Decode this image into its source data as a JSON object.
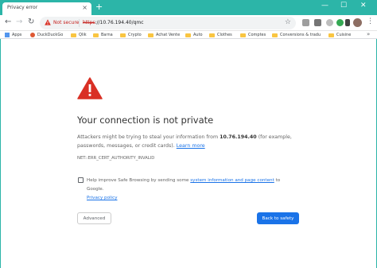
{
  "tab": {
    "title": "Privacy error",
    "close_glyph": "×",
    "new_tab_glyph": "+"
  },
  "window_controls": {
    "minimize": "—",
    "maximize": "☐",
    "close": "✕"
  },
  "nav": {
    "back": "←",
    "forward": "→",
    "reload": "↻"
  },
  "omnibox": {
    "security_label": "Not secure",
    "url_scheme": "https",
    "url_rest": "://10.76.194.40/qmc",
    "star_icon": "☆"
  },
  "extensions": [
    {
      "name": "extension-1-icon",
      "color": "#9e9e9e"
    },
    {
      "name": "extension-2-icon",
      "color": "#757575"
    },
    {
      "name": "extension-3-icon",
      "color": "#bdbdbd"
    },
    {
      "name": "extension-4-icon",
      "color": "#34a853"
    },
    {
      "name": "extension-5-icon",
      "color": "#424242"
    }
  ],
  "bookmarks": {
    "apps": "Apps",
    "items": [
      "DuckDuckGo",
      "Qlik",
      "Barna",
      "Crypto",
      "Achat Vente",
      "Auto",
      "Clothes",
      "Comptes",
      "Conversions & tradu",
      "Cuisine"
    ],
    "more": "»"
  },
  "content": {
    "heading": "Your connection is not private",
    "body_prefix": "Attackers might be trying to steal your information from ",
    "body_host": "10.76.194.40",
    "body_suffix": " (for example, passwords, messages, or credit cards). ",
    "learn_more": "Learn more",
    "error_code": "NET::ERR_CERT_AUTHORITY_INVALID",
    "safe_browsing_prefix": "Help improve Safe Browsing by sending some ",
    "safe_browsing_link": "system information and page content",
    "safe_browsing_suffix": " to Google.",
    "privacy_policy": "Privacy policy",
    "checkbox_checked": false
  },
  "buttons": {
    "advanced": "Advanced",
    "back_to_safety": "Back to safety"
  },
  "colors": {
    "accent": "#1a73e8",
    "frame": "#2cb5a8",
    "warning": "#d93025"
  }
}
